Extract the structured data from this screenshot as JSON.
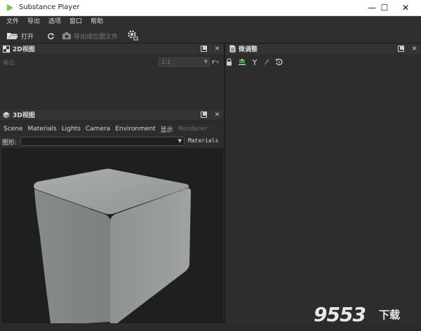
{
  "window": {
    "title": "Substance Player",
    "minimize": "—",
    "maximize": "☐",
    "close": "✕"
  },
  "menu": [
    "文件",
    "导出",
    "选项",
    "窗口",
    "帮助"
  ],
  "toolbar": {
    "open_label": "打开",
    "export_label": "导出成位图文件"
  },
  "panel2d": {
    "title": "2D视图",
    "output_label": "输出:",
    "zoom_value": "1:1"
  },
  "panel3d": {
    "title": "3D视图",
    "tabs": [
      "Scene",
      "Materials",
      "Lights",
      "Camera",
      "Environment",
      "显示",
      "Renderer"
    ],
    "shape_label": "图形:",
    "shape_value": "",
    "materials_button": "Materials"
  },
  "tweaks": {
    "title": "微调整"
  },
  "watermark": {
    "main": "9553",
    "sub": "下载"
  },
  "colors": {
    "background": "#2b2b2b",
    "panel": "#2d2d2d",
    "viewport": "#1f1f1f",
    "accent_green": "#5fd35f"
  }
}
